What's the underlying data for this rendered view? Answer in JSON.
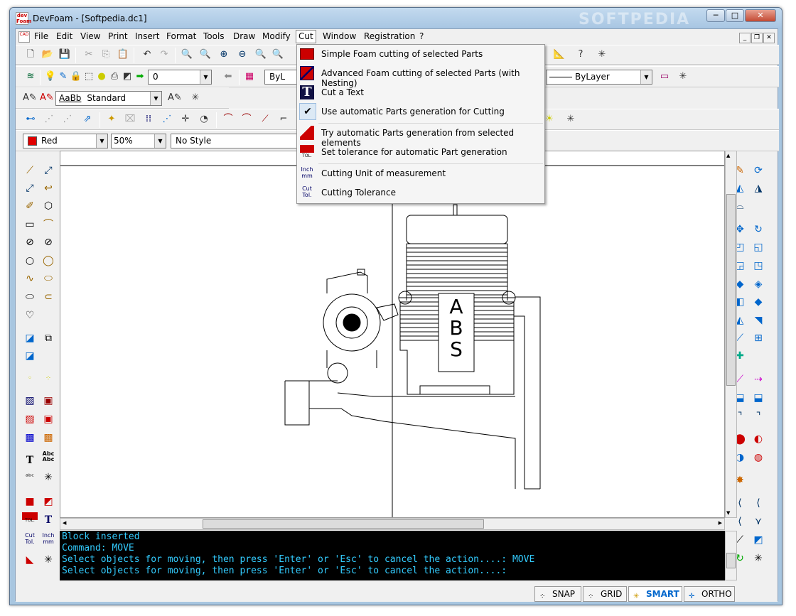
{
  "window": {
    "title": "DevFoam - [Softpedia.dc1]",
    "app_icon_text": "dev Foam",
    "minimize": "─",
    "maximize": "□",
    "close": "✕"
  },
  "menubar": {
    "items": [
      "File",
      "Edit",
      "View",
      "Print",
      "Insert",
      "Format",
      "Tools",
      "Draw",
      "Modify",
      "Cut",
      "Window",
      "Registration",
      "?"
    ],
    "active": "Cut",
    "mdi_buttons": [
      "_",
      "❐",
      "✕"
    ]
  },
  "properties_bar": {
    "layer_value": "0",
    "linetype_partial": "ByL",
    "linetype_right": "ByLayer"
  },
  "text_bar": {
    "style_sample": "AaBb",
    "style_value": "Standard"
  },
  "format_bar": {
    "color_value": "Red",
    "color_hex": "#e00000",
    "opacity_value": "50%",
    "style_value": "No Style"
  },
  "cut_menu": {
    "items": [
      {
        "label": "Simple Foam cutting of selected Parts",
        "icon": "simple-cut-icon"
      },
      {
        "label": "Advanced Foam cutting of selected Parts (with Nesting)",
        "icon": "advanced-cut-icon"
      },
      {
        "label": "Cut a Text",
        "icon": "cut-text-icon"
      },
      {
        "label": "Use automatic Parts generation for Cutting",
        "icon": "checkmark-icon",
        "checked": true
      },
      {
        "label": "Try automatic Parts generation from selected elements",
        "icon": "auto-parts-icon"
      },
      {
        "label": "Set tolerance for automatic Part generation",
        "icon": "tolerance-icon",
        "icon_text": "TOL."
      },
      {
        "label": "Cutting Unit of measurement",
        "icon": "unit-icon",
        "icon_text": "Inch mm"
      },
      {
        "label": "Cutting Tolerance",
        "icon": "cut-tolerance-icon",
        "icon_text": "Cut Tol."
      }
    ]
  },
  "drawing": {
    "block_text": [
      "A",
      "B",
      "S"
    ]
  },
  "left_tools_extra": {
    "tol_label": "TOL.",
    "cut_tol_label": "Cut Tol.",
    "inch_mm_label": "Inch mm",
    "text_tool": "T",
    "abc_tool": "Abc Abc"
  },
  "console": {
    "lines": [
      "Block inserted",
      "Command: MOVE",
      "Select objects for moving, then press 'Enter' or 'Esc' to cancel the action....: MOVE",
      "Select objects for moving, then press 'Enter' or 'Esc' to cancel the action....:"
    ],
    "text_color": "#33ccff"
  },
  "statusbar": {
    "buttons": [
      {
        "label": "SNAP",
        "on": false
      },
      {
        "label": "GRID",
        "on": false
      },
      {
        "label": "SMART",
        "on": true
      },
      {
        "label": "ORTHO",
        "on": false
      }
    ]
  },
  "watermark": "SOFTPEDIA"
}
